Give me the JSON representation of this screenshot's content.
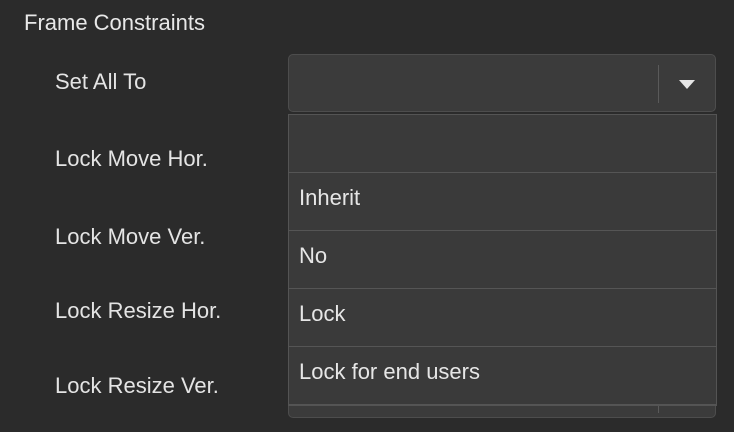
{
  "section": {
    "title": "Frame Constraints"
  },
  "rows": [
    {
      "label": "Set All To"
    },
    {
      "label": "Lock Move Hor."
    },
    {
      "label": "Lock Move Ver."
    },
    {
      "label": "Lock Resize Hor."
    },
    {
      "label": "Lock Resize Ver."
    }
  ],
  "select": {
    "value": "",
    "icon": "chevron-down-icon"
  },
  "dropdown": {
    "options": [
      "",
      "Inherit",
      "No",
      "Lock",
      "Lock for end users"
    ]
  },
  "colors": {
    "background": "#2b2b2b",
    "control": "#3b3b3b",
    "border": "#555555",
    "text": "#e6e6e6"
  }
}
